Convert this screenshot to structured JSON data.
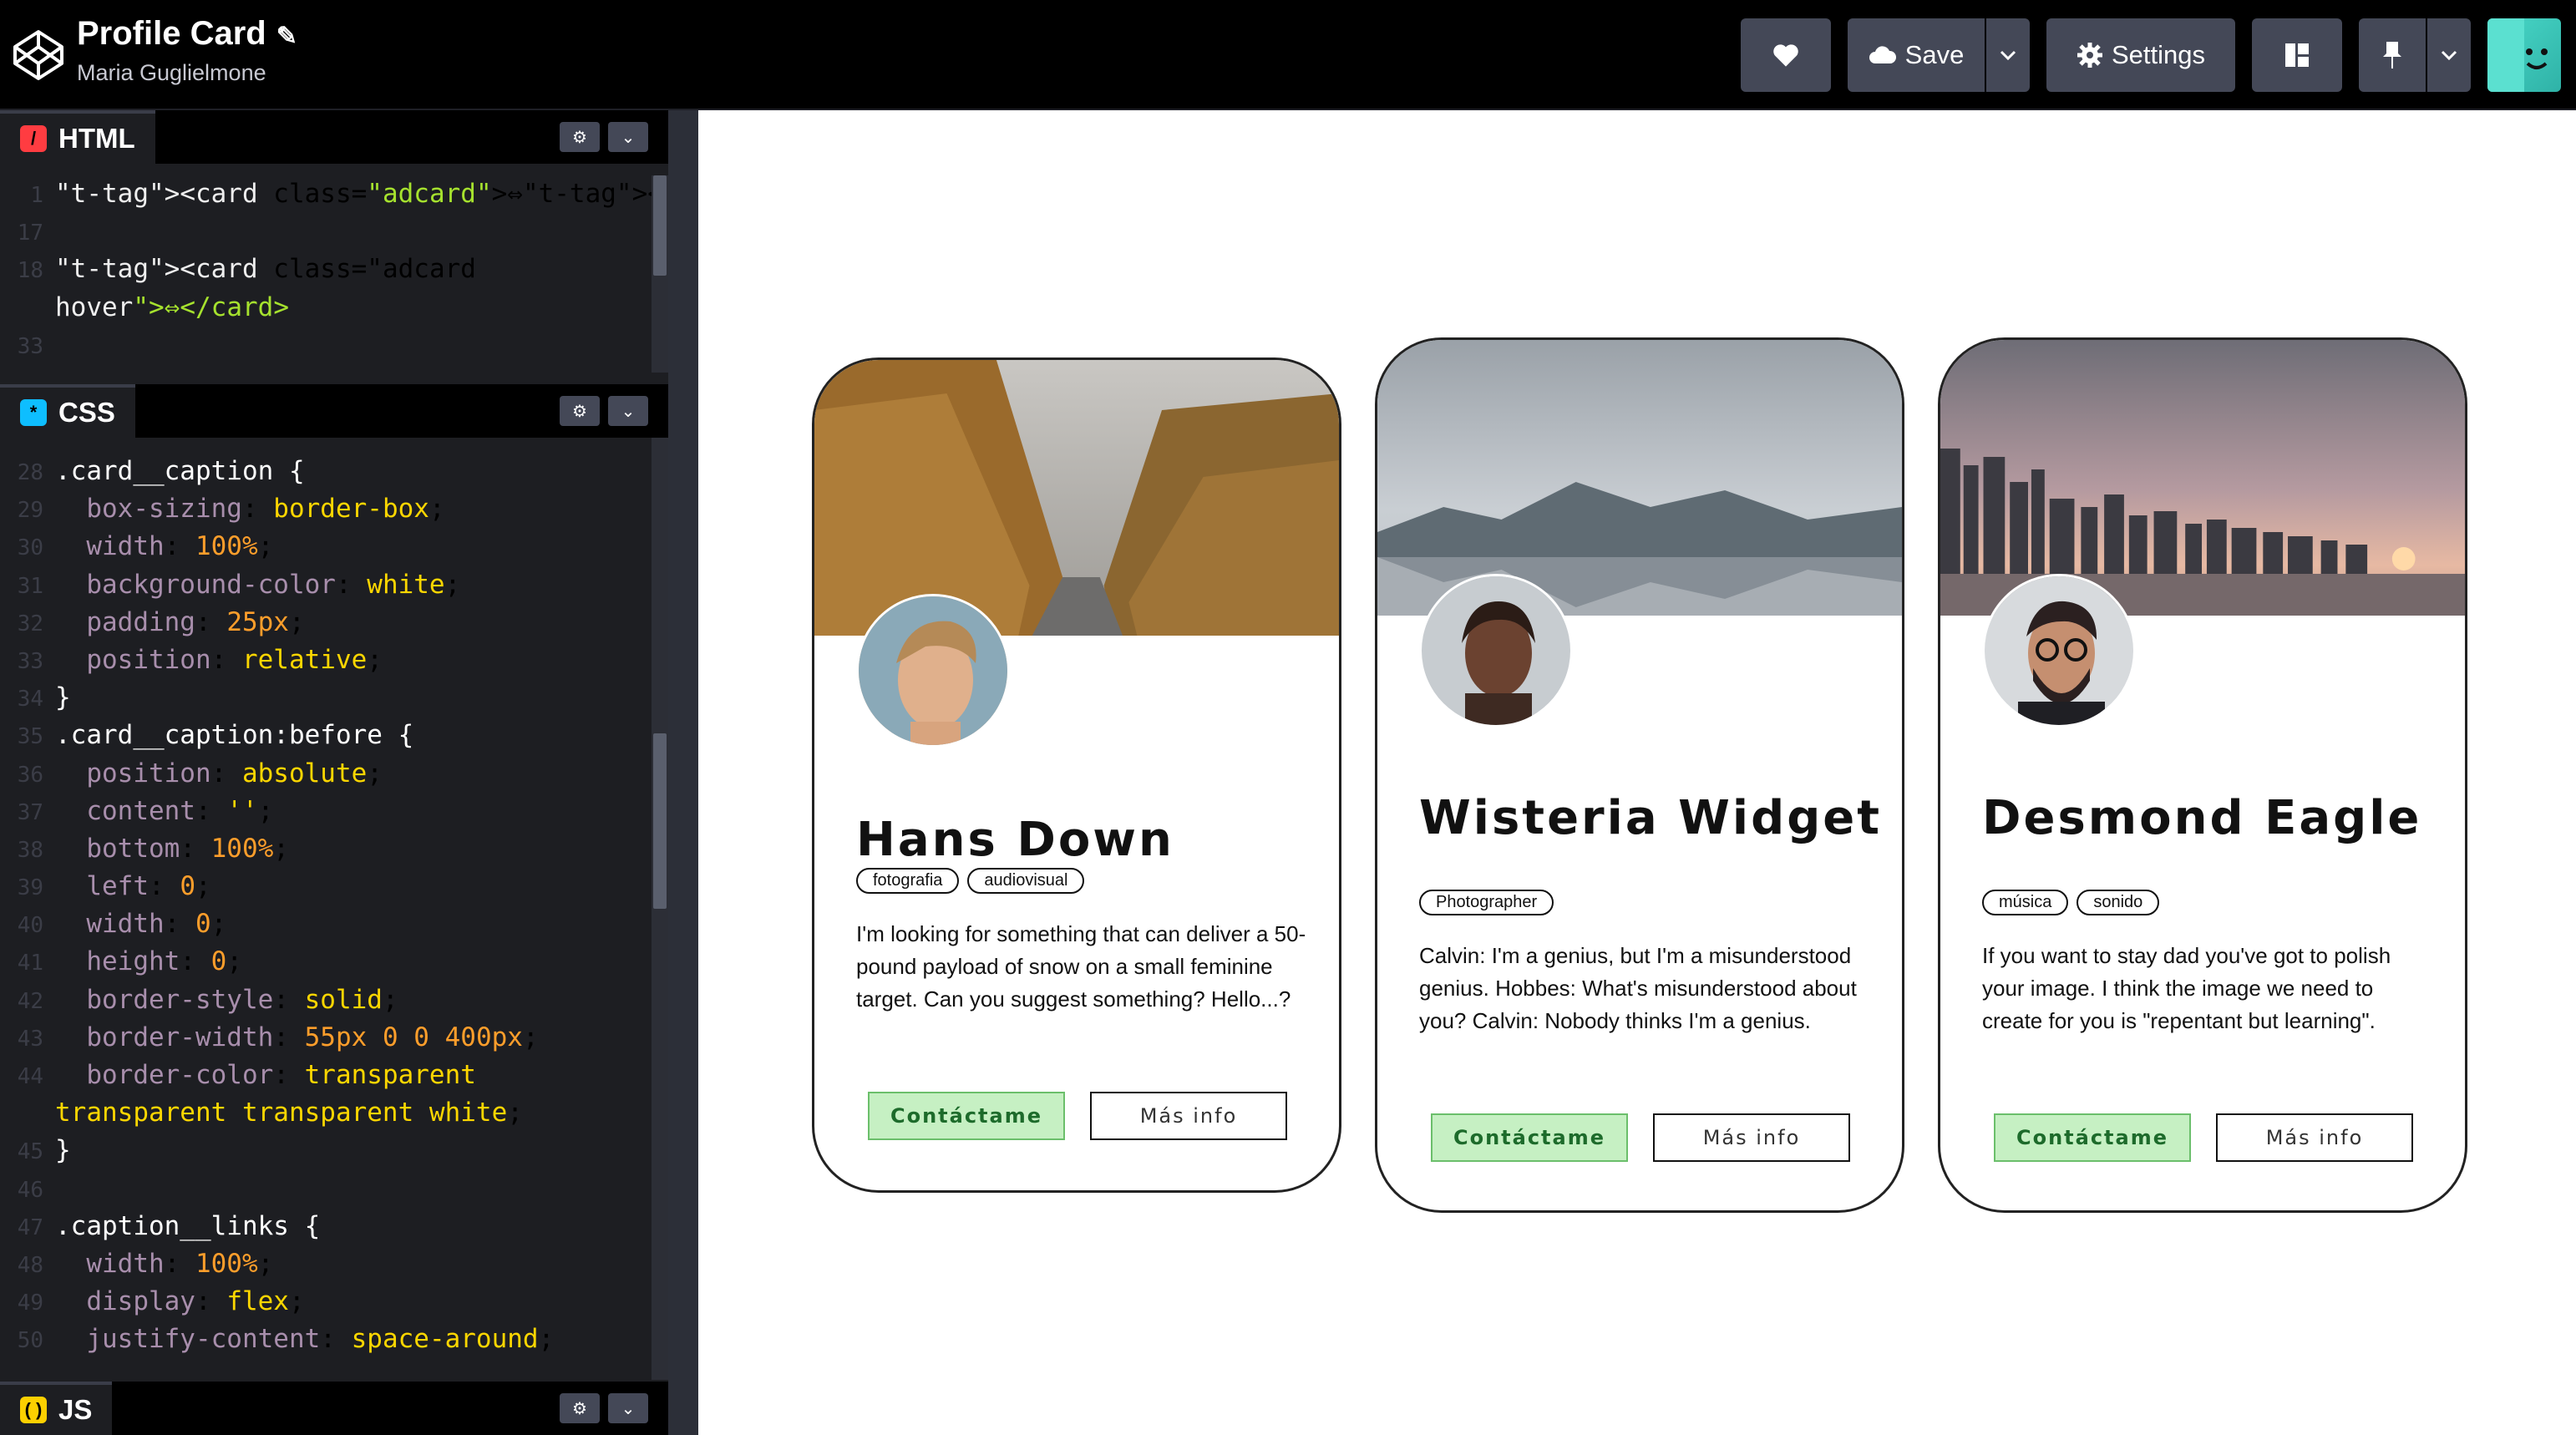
{
  "header": {
    "title": "Profile Card",
    "author": "Maria Guglielmone",
    "save_label": "Save",
    "settings_label": "Settings"
  },
  "html_panel": {
    "label": "HTML",
    "lines": [
      {
        "n": "1",
        "code": "<card class=\"adcard\">⇔</card>"
      },
      {
        "n": "17",
        "code": ""
      },
      {
        "n": "18",
        "code": "<card class=\"adcard"
      },
      {
        "n": "",
        "code": "hover\">⇔</card>"
      },
      {
        "n": "33",
        "code": ""
      }
    ]
  },
  "css_panel": {
    "label": "CSS",
    "lines": [
      {
        "n": "28",
        "code": ".card__caption {"
      },
      {
        "n": "29",
        "code": "  box-sizing: border-box;"
      },
      {
        "n": "30",
        "code": "  width: 100%;"
      },
      {
        "n": "31",
        "code": "  background-color: white;"
      },
      {
        "n": "32",
        "code": "  padding: 25px;"
      },
      {
        "n": "33",
        "code": "  position: relative;"
      },
      {
        "n": "34",
        "code": "}"
      },
      {
        "n": "35",
        "code": ".card__caption:before {"
      },
      {
        "n": "36",
        "code": "  position: absolute;"
      },
      {
        "n": "37",
        "code": "  content: '';"
      },
      {
        "n": "38",
        "code": "  bottom: 100%;"
      },
      {
        "n": "39",
        "code": "  left: 0;"
      },
      {
        "n": "40",
        "code": "  width: 0;"
      },
      {
        "n": "41",
        "code": "  height: 0;"
      },
      {
        "n": "42",
        "code": "  border-style: solid;"
      },
      {
        "n": "43",
        "code": "  border-width: 55px 0 0 400px;"
      },
      {
        "n": "44",
        "code": "  border-color: transparent"
      },
      {
        "n": "",
        "code": "transparent transparent white;"
      },
      {
        "n": "45",
        "code": "}"
      },
      {
        "n": "46",
        "code": ""
      },
      {
        "n": "47",
        "code": ".caption__links {"
      },
      {
        "n": "48",
        "code": "  width: 100%;"
      },
      {
        "n": "49",
        "code": "  display: flex;"
      },
      {
        "n": "50",
        "code": "  justify-content: space-around;"
      }
    ]
  },
  "js_panel": {
    "label": "JS"
  },
  "cards": [
    {
      "name": "Hans Down",
      "tags": [
        "fotografia",
        "audiovisual"
      ],
      "bio": "I'm looking for something that can deliver a 50-pound payload of snow on a small feminine target. Can you suggest something? Hello...?",
      "contact_label": "Contáctame",
      "info_label": "Más info"
    },
    {
      "name": "Wisteria Widget",
      "tags": [
        "Photographer"
      ],
      "bio": "Calvin: I'm a genius, but I'm a misunderstood genius. Hobbes: What's misunderstood about you? Calvin: Nobody thinks I'm a genius.",
      "contact_label": "Contáctame",
      "info_label": "Más info"
    },
    {
      "name": "Desmond Eagle",
      "tags": [
        "música",
        "sonido"
      ],
      "bio": "If you want to stay dad you've got to polish your image. I think the image we need to create for you is \"repentant but learning\".",
      "contact_label": "Contáctame",
      "info_label": "Más info"
    }
  ],
  "colors": {
    "accent_green": "#c6f0c3",
    "editor_bg": "#1d1e22",
    "toolbar_button": "#444857"
  }
}
